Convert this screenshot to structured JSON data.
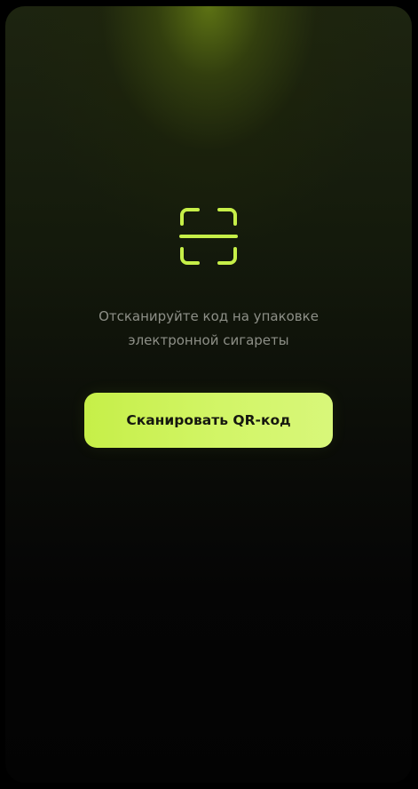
{
  "scan": {
    "icon": "qr-scan-frame-icon",
    "accent_color": "#c6ef48",
    "hint_line1": "Отсканируйте код на упаковке",
    "hint_line2": "электронной сигареты",
    "button_label": "Сканировать QR-код"
  }
}
